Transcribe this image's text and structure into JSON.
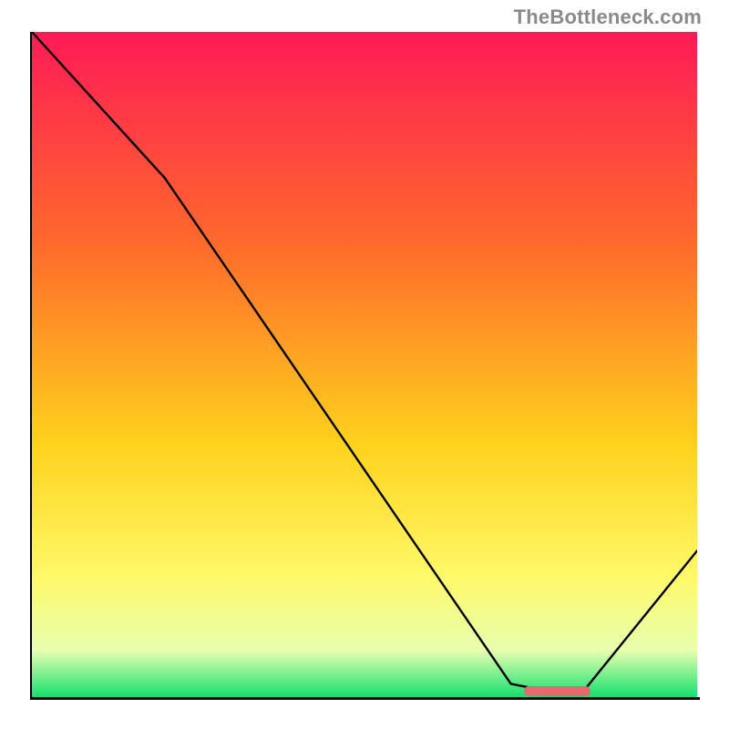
{
  "watermark": "TheBottleneck.com",
  "colors": {
    "grad_top": "#ff1a57",
    "grad_mid1": "#ff6a2b",
    "grad_mid2": "#ffd21c",
    "grad_mid3": "#fff96a",
    "grad_mid4": "#e8ffb0",
    "grad_bottom": "#15e06e",
    "curve": "#000000",
    "axis": "#000000",
    "marker": "#e46a6f",
    "watermark": "#8a8a8a"
  },
  "chart_data": {
    "type": "line",
    "title": "",
    "xlabel": "",
    "ylabel": "",
    "xlim": [
      0,
      100
    ],
    "ylim": [
      0,
      100
    ],
    "x": [
      0,
      20,
      72,
      77,
      83,
      100
    ],
    "values": [
      100,
      78,
      2,
      1,
      1,
      22
    ],
    "marker": {
      "x_start": 74,
      "x_end": 84,
      "y": 1
    },
    "gradient_stops": [
      {
        "offset": 0.0,
        "color": "#ff1a57"
      },
      {
        "offset": 0.32,
        "color": "#ff6a2b"
      },
      {
        "offset": 0.62,
        "color": "#ffd21c"
      },
      {
        "offset": 0.82,
        "color": "#fff96a"
      },
      {
        "offset": 0.93,
        "color": "#e8ffb0"
      },
      {
        "offset": 1.0,
        "color": "#15e06e"
      }
    ]
  }
}
